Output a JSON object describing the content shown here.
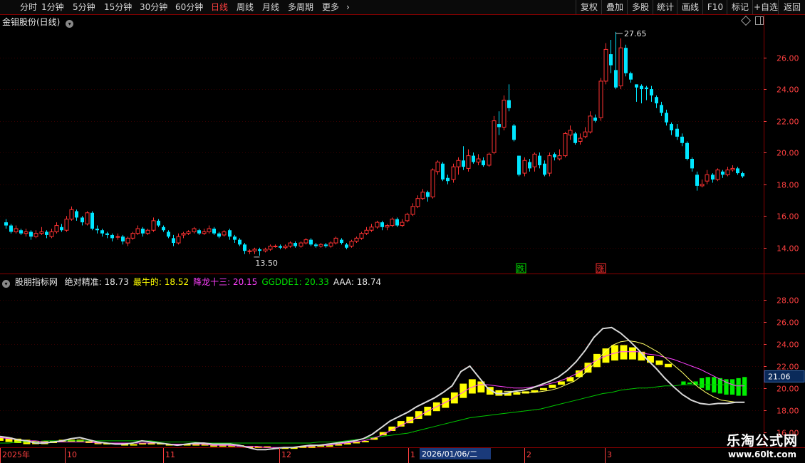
{
  "toolbar": {
    "left_items": [
      "分时",
      "1分钟",
      "5分钟",
      "15分钟",
      "30分钟",
      "60分钟",
      "日线",
      "周线",
      "月线",
      "多周期",
      "更多"
    ],
    "active": "日线",
    "more_arrow": "›",
    "right_items": [
      "复权",
      "叠加",
      "多股",
      "统计",
      "画线",
      "F10",
      "标记",
      "+自选",
      "返回"
    ]
  },
  "main_panel": {
    "title": "金钼股份(日线)",
    "title_icon": "chevron-down-icon",
    "corner_icons": [
      "diamond-icon",
      "panel-toggle-icon"
    ],
    "y_ticks": [
      "14.00",
      "16.00",
      "18.00",
      "20.00",
      "22.00",
      "24.00",
      "26.00"
    ],
    "high_label": "27.65",
    "low_label": "13.50",
    "signals": [
      {
        "text": "跌",
        "color": "#00e000"
      },
      {
        "text": "涨",
        "color": "#ff3030"
      }
    ]
  },
  "indicator_panel": {
    "name": "股朋指标网",
    "values": [
      {
        "label": "绝对精准:",
        "value": "18.73",
        "color": "#e8e8e8"
      },
      {
        "label": "最牛的:",
        "value": "18.52",
        "color": "#ffff00"
      },
      {
        "label": "降龙十三:",
        "value": "20.15",
        "color": "#ff40ff"
      },
      {
        "label": "GGDDE1:",
        "value": "20.33",
        "color": "#00e000"
      },
      {
        "label": "AAA:",
        "value": "18.74",
        "color": "#e8e8e8"
      }
    ],
    "y_ticks": [
      "16.00",
      "18.00",
      "20.00",
      "22.00",
      "24.00",
      "26.00",
      "28.00"
    ],
    "current_value": "21.06"
  },
  "date_axis": {
    "labels": [
      "2025年",
      "10",
      "11",
      "12",
      "1",
      "2",
      "3"
    ],
    "highlight": "2026/01/06/二"
  },
  "watermark": {
    "line1": "乐淘公式网",
    "line2": "www.60lt.com"
  },
  "colors": {
    "up": "#ff3232",
    "down": "#00e6ff",
    "grid": "#3a0000",
    "axis": "#8b0000",
    "tick": "#ff4040"
  },
  "chart_data": {
    "type": "candlestick",
    "y_range": [
      13,
      28
    ],
    "candles": [
      [
        15.6,
        15.4,
        15.8,
        15.2
      ],
      [
        15.4,
        15.0,
        15.5,
        14.9
      ],
      [
        15.0,
        15.2,
        15.4,
        14.9
      ],
      [
        15.1,
        14.9,
        15.2,
        14.8
      ],
      [
        14.9,
        15.0,
        15.2,
        14.7
      ],
      [
        15.0,
        14.7,
        15.1,
        14.5
      ],
      [
        14.7,
        14.9,
        15.1,
        14.6
      ],
      [
        14.9,
        15.0,
        15.3,
        14.8
      ],
      [
        15.0,
        14.8,
        15.1,
        14.6
      ],
      [
        14.7,
        15.0,
        15.2,
        14.6
      ],
      [
        15.0,
        15.4,
        15.6,
        14.9
      ],
      [
        15.3,
        15.1,
        15.5,
        15.0
      ],
      [
        15.1,
        15.8,
        16.0,
        15.0
      ],
      [
        15.8,
        16.4,
        16.6,
        15.7
      ],
      [
        16.3,
        15.9,
        16.4,
        15.7
      ],
      [
        15.9,
        15.6,
        16.0,
        15.4
      ],
      [
        15.5,
        16.2,
        16.3,
        15.4
      ],
      [
        16.2,
        15.2,
        16.3,
        15.1
      ],
      [
        15.2,
        15.1,
        15.4,
        14.9
      ],
      [
        15.1,
        14.9,
        15.2,
        14.7
      ],
      [
        14.9,
        14.8,
        15.0,
        14.6
      ],
      [
        14.8,
        14.6,
        14.9,
        14.4
      ],
      [
        14.7,
        14.7,
        14.9,
        14.5
      ],
      [
        14.7,
        14.4,
        14.8,
        14.2
      ],
      [
        14.3,
        14.6,
        14.7,
        14.1
      ],
      [
        14.6,
        14.9,
        15.0,
        14.5
      ],
      [
        14.9,
        15.2,
        15.4,
        14.8
      ],
      [
        15.2,
        14.9,
        15.3,
        14.7
      ],
      [
        14.9,
        15.1,
        15.2,
        14.8
      ],
      [
        15.1,
        15.7,
        15.9,
        15.0
      ],
      [
        15.7,
        15.4,
        15.8,
        15.3
      ],
      [
        15.3,
        15.1,
        15.4,
        15.0
      ],
      [
        15.0,
        14.7,
        15.1,
        14.6
      ],
      [
        14.6,
        14.3,
        14.8,
        14.1
      ],
      [
        14.3,
        14.7,
        14.9,
        14.2
      ],
      [
        14.8,
        14.9,
        15.0,
        14.6
      ],
      [
        14.9,
        15.0,
        15.1,
        14.8
      ],
      [
        15.0,
        15.2,
        15.3,
        14.9
      ],
      [
        15.1,
        14.9,
        15.2,
        14.8
      ],
      [
        14.9,
        15.0,
        15.2,
        14.8
      ],
      [
        15.0,
        15.2,
        15.4,
        14.9
      ],
      [
        15.2,
        14.9,
        15.3,
        14.8
      ],
      [
        14.9,
        14.7,
        15.0,
        14.6
      ],
      [
        14.8,
        15.0,
        15.1,
        14.7
      ],
      [
        15.1,
        14.7,
        15.2,
        14.5
      ],
      [
        14.7,
        14.5,
        14.8,
        14.3
      ],
      [
        14.5,
        14.2,
        14.6,
        14.1
      ],
      [
        14.2,
        13.8,
        14.3,
        13.6
      ],
      [
        13.8,
        13.8,
        13.9,
        13.6
      ],
      [
        13.8,
        13.9,
        14.0,
        13.6
      ],
      [
        13.9,
        13.8,
        14.0,
        13.5
      ],
      [
        13.8,
        13.9,
        14.0,
        13.7
      ],
      [
        13.9,
        14.1,
        14.2,
        13.8
      ],
      [
        14.1,
        14.1,
        14.2,
        14.0
      ],
      [
        14.1,
        14.0,
        14.2,
        13.9
      ],
      [
        14.0,
        14.1,
        14.2,
        13.9
      ],
      [
        14.1,
        14.3,
        14.4,
        14.0
      ],
      [
        14.3,
        14.1,
        14.4,
        14.0
      ],
      [
        14.1,
        14.3,
        14.4,
        14.0
      ],
      [
        14.3,
        14.5,
        14.6,
        14.2
      ],
      [
        14.5,
        14.2,
        14.6,
        14.1
      ],
      [
        14.2,
        14.1,
        14.3,
        14.0
      ],
      [
        14.1,
        14.2,
        14.3,
        14.0
      ],
      [
        14.2,
        14.1,
        14.3,
        14.0
      ],
      [
        14.1,
        14.3,
        14.4,
        14.0
      ],
      [
        14.3,
        14.6,
        14.7,
        14.2
      ],
      [
        14.5,
        14.3,
        14.6,
        14.2
      ],
      [
        14.2,
        14.0,
        14.3,
        13.9
      ],
      [
        14.1,
        14.4,
        14.5,
        14.0
      ],
      [
        14.4,
        14.6,
        14.7,
        14.3
      ],
      [
        14.6,
        14.9,
        15.0,
        14.5
      ],
      [
        14.9,
        15.1,
        15.3,
        14.8
      ],
      [
        15.1,
        15.3,
        15.5,
        15.0
      ],
      [
        15.3,
        15.6,
        15.7,
        15.2
      ],
      [
        15.6,
        15.3,
        15.7,
        15.1
      ],
      [
        15.3,
        15.4,
        15.5,
        15.1
      ],
      [
        15.4,
        15.8,
        15.9,
        15.3
      ],
      [
        15.8,
        15.4,
        15.9,
        15.3
      ],
      [
        15.4,
        15.6,
        15.8,
        15.3
      ],
      [
        15.7,
        16.1,
        16.2,
        15.6
      ],
      [
        16.1,
        16.6,
        16.8,
        16.0
      ],
      [
        16.6,
        17.1,
        17.3,
        16.5
      ],
      [
        17.1,
        17.5,
        17.7,
        17.0
      ],
      [
        17.5,
        17.2,
        17.6,
        16.9
      ],
      [
        17.2,
        18.9,
        19.0,
        17.1
      ],
      [
        18.8,
        19.4,
        19.5,
        18.6
      ],
      [
        19.3,
        18.3,
        19.4,
        18.2
      ],
      [
        18.4,
        18.2,
        18.6,
        18.0
      ],
      [
        18.3,
        19.1,
        19.3,
        18.1
      ],
      [
        19.1,
        19.5,
        19.7,
        18.6
      ],
      [
        19.5,
        19.1,
        20.4,
        18.9
      ],
      [
        19.0,
        19.8,
        20.2,
        18.8
      ],
      [
        19.8,
        19.4,
        20.0,
        19.3
      ],
      [
        19.4,
        19.6,
        19.9,
        19.2
      ],
      [
        19.5,
        19.2,
        19.7,
        19.1
      ],
      [
        19.2,
        19.9,
        20.0,
        19.1
      ],
      [
        20.0,
        22.0,
        22.3,
        19.9
      ],
      [
        21.8,
        21.6,
        22.6,
        21.1
      ],
      [
        21.6,
        23.3,
        23.6,
        21.4
      ],
      [
        23.3,
        22.8,
        24.3,
        22.6
      ],
      [
        21.7,
        20.8,
        21.8,
        20.7
      ],
      [
        19.8,
        18.6,
        19.8,
        18.5
      ],
      [
        18.7,
        19.5,
        19.7,
        18.5
      ],
      [
        19.4,
        19.0,
        19.6,
        18.8
      ],
      [
        19.1,
        19.9,
        20.0,
        18.8
      ],
      [
        19.8,
        19.2,
        20.0,
        19.0
      ],
      [
        19.3,
        18.6,
        19.5,
        18.5
      ],
      [
        18.7,
        19.8,
        20.0,
        18.5
      ],
      [
        19.9,
        19.7,
        20.0,
        19.5
      ],
      [
        19.6,
        19.8,
        20.2,
        19.5
      ],
      [
        19.8,
        21.2,
        21.3,
        19.7
      ],
      [
        21.1,
        21.4,
        21.7,
        20.8
      ],
      [
        21.2,
        20.6,
        21.3,
        20.5
      ],
      [
        20.7,
        20.9,
        21.2,
        20.5
      ],
      [
        21.0,
        21.3,
        21.6,
        20.9
      ],
      [
        21.3,
        22.3,
        22.6,
        21.2
      ],
      [
        22.2,
        22.0,
        22.4,
        21.9
      ],
      [
        22.2,
        24.5,
        24.7,
        22.0
      ],
      [
        24.5,
        26.5,
        26.9,
        24.3
      ],
      [
        26.2,
        25.5,
        27.1,
        25.0
      ],
      [
        25.2,
        24.1,
        27.6,
        24.0
      ],
      [
        24.2,
        26.6,
        27.2,
        24.0
      ],
      [
        26.6,
        25.0,
        26.8,
        24.8
      ],
      [
        25.0,
        24.6,
        25.1,
        24.4
      ],
      [
        24.3,
        24.1,
        24.3,
        23.2
      ],
      [
        24.2,
        24.0,
        24.3,
        23.1
      ],
      [
        24.1,
        24.0,
        24.2,
        23.3
      ],
      [
        24.0,
        23.6,
        24.2,
        23.2
      ],
      [
        23.5,
        23.1,
        23.6,
        22.8
      ],
      [
        23.0,
        22.5,
        23.2,
        22.3
      ],
      [
        22.5,
        21.9,
        22.7,
        21.7
      ],
      [
        21.8,
        21.4,
        21.9,
        21.1
      ],
      [
        21.5,
        21.0,
        21.8,
        20.8
      ],
      [
        21.0,
        20.6,
        21.2,
        20.4
      ],
      [
        20.6,
        19.6,
        20.7,
        19.5
      ],
      [
        19.6,
        19.0,
        19.7,
        18.8
      ],
      [
        18.6,
        17.9,
        18.8,
        17.6
      ],
      [
        17.9,
        18.0,
        18.3,
        17.8
      ],
      [
        18.2,
        18.6,
        18.9,
        18.0
      ],
      [
        18.6,
        18.3,
        18.7,
        18.1
      ],
      [
        18.3,
        18.9,
        19.0,
        18.2
      ],
      [
        18.8,
        18.6,
        18.9,
        18.4
      ],
      [
        18.6,
        18.9,
        19.1,
        18.5
      ],
      [
        18.9,
        19.0,
        19.2,
        18.8
      ],
      [
        19.0,
        18.7,
        19.1,
        18.6
      ],
      [
        18.7,
        18.5,
        18.8,
        18.4
      ]
    ],
    "indicator": {
      "y_range": [
        15,
        29.5
      ],
      "white_line": [
        15.6,
        15.5,
        15.3,
        15.2,
        15.0,
        15.0,
        15.1,
        15.2,
        15.4,
        15.5,
        15.3,
        15.1,
        15.0,
        14.9,
        14.9,
        15.0,
        15.2,
        15.1,
        15.0,
        14.9,
        14.8,
        14.9,
        15.0,
        15.0,
        14.9,
        14.9,
        14.9,
        14.8,
        14.6,
        14.4,
        14.4,
        14.5,
        14.6,
        14.6,
        14.7,
        14.8,
        14.8,
        14.9,
        15.0,
        15.1,
        15.2,
        15.4,
        15.8,
        16.4,
        17.0,
        17.4,
        17.8,
        18.3,
        18.7,
        19.1,
        19.6,
        20.2,
        21.5,
        22.0,
        21.0,
        20.0,
        19.5,
        19.5,
        19.7,
        19.8,
        20.0,
        20.3,
        20.6,
        21.0,
        21.6,
        22.4,
        23.4,
        24.6,
        25.4,
        25.5,
        25.0,
        24.3,
        23.5,
        22.6,
        21.8,
        20.9,
        20.1,
        19.4,
        18.9,
        18.6,
        18.5,
        18.6,
        18.6,
        18.7,
        18.7
      ],
      "white_start": 0,
      "yellow_bar_top": [
        15.2,
        15.1,
        15.0,
        14.9,
        14.9,
        14.9,
        15.0,
        15.1,
        15.1,
        15.1,
        15.0,
        14.9,
        14.9,
        14.9,
        14.9,
        14.9,
        15.0,
        15.0,
        15.0,
        14.9,
        14.9,
        14.9,
        14.9,
        14.9,
        14.8,
        14.8,
        14.8,
        14.7,
        14.6,
        14.6,
        14.6,
        14.6,
        14.6,
        14.6,
        14.7,
        14.7,
        14.8,
        14.8,
        14.9,
        15.0,
        15.1,
        15.2,
        15.5,
        16.0,
        16.5,
        17.0,
        17.4,
        17.9,
        18.3,
        18.7,
        19.1,
        19.6,
        20.4,
        20.8,
        20.6,
        20.1,
        19.8,
        19.6,
        19.6,
        19.7,
        19.8,
        20.0,
        20.3,
        20.6,
        21.0,
        21.6,
        22.3,
        23.1,
        23.6,
        23.9,
        23.9,
        23.7,
        23.3,
        22.9,
        22.5,
        22.2
      ],
      "yellow_bar_bottom": [
        15.6,
        15.5,
        15.4,
        15.3,
        15.2,
        15.2,
        15.2,
        15.3,
        15.3,
        15.3,
        15.2,
        15.1,
        15.0,
        15.0,
        14.9,
        14.9,
        15.0,
        15.0,
        14.9,
        14.9,
        14.8,
        14.8,
        14.8,
        14.8,
        14.8,
        14.8,
        14.8,
        14.8,
        14.7,
        14.7,
        14.7,
        14.6,
        14.6,
        14.6,
        14.6,
        14.7,
        14.7,
        14.8,
        14.8,
        14.9,
        15.0,
        15.1,
        15.3,
        15.7,
        16.1,
        16.5,
        16.8,
        17.2,
        17.5,
        17.9,
        18.2,
        18.6,
        19.1,
        19.5,
        19.6,
        19.4,
        19.3,
        19.3,
        19.4,
        19.5,
        19.6,
        19.8,
        20.0,
        20.3,
        20.6,
        21.0,
        21.4,
        21.9,
        22.3,
        22.5,
        22.6,
        22.6,
        22.5,
        22.3,
        22.1,
        21.9
      ],
      "green_bar_top": [
        20.3,
        20.4,
        20.6,
        20.9,
        21.0,
        21.0,
        20.9,
        20.8,
        20.8,
        20.9,
        21.0
      ],
      "green_bar_bottom": [
        20.6,
        20.5,
        20.3,
        20.0,
        19.8,
        19.6,
        19.5,
        19.4,
        19.4,
        19.3,
        19.3
      ],
      "magenta_line": [
        15.5,
        15.4,
        15.3,
        15.2,
        15.2,
        15.1,
        15.1,
        15.1,
        15.1,
        15.1,
        15.1,
        15.0,
        15.0,
        15.0,
        15.0,
        15.0,
        15.0,
        15.0,
        15.0,
        14.9,
        14.9,
        14.9,
        14.9,
        14.9,
        14.8,
        14.8,
        14.8,
        14.7,
        14.7,
        14.7,
        14.6,
        14.6,
        14.6,
        14.6,
        14.7,
        14.7,
        14.8,
        14.8,
        14.9,
        15.0,
        15.1,
        15.2,
        15.4,
        15.7,
        16.1,
        16.5,
        16.9,
        17.3,
        17.8,
        18.2,
        18.6,
        19.0,
        19.5,
        20.0,
        20.3,
        20.3,
        20.2,
        20.1,
        20.0,
        20.0,
        20.1,
        20.2,
        20.4,
        20.6,
        20.9,
        21.3,
        21.8,
        22.4,
        22.8,
        23.1,
        23.3,
        23.3,
        23.3,
        23.1,
        23.0,
        22.8,
        22.6,
        22.3,
        22.0,
        21.7,
        21.3,
        20.9,
        20.5,
        20.2,
        20.2
      ],
      "green_line": [
        15.0,
        15.0,
        15.1,
        15.1,
        15.1,
        15.2,
        15.2,
        15.2,
        15.2,
        15.2,
        15.2,
        15.2,
        15.2,
        15.2,
        15.2,
        15.2,
        15.2,
        15.2,
        15.1,
        15.1,
        15.1,
        15.1,
        15.1,
        15.0,
        15.0,
        15.0,
        15.0,
        15.0,
        15.0,
        15.0,
        15.0,
        15.0,
        15.0,
        15.0,
        15.0,
        15.0,
        15.1,
        15.1,
        15.1,
        15.2,
        15.3,
        15.4,
        15.5,
        15.6,
        15.7,
        15.8,
        15.9,
        16.1,
        16.3,
        16.5,
        16.7,
        16.9,
        17.1,
        17.3,
        17.4,
        17.5,
        17.6,
        17.7,
        17.8,
        17.9,
        18.0,
        18.1,
        18.3,
        18.5,
        18.7,
        18.9,
        19.1,
        19.3,
        19.5,
        19.6,
        19.8,
        19.9,
        20.0,
        20.0,
        20.1,
        20.2,
        20.2,
        20.3,
        20.3,
        20.3,
        20.3,
        20.3,
        20.3,
        20.3,
        20.3
      ],
      "thin_yellow_line": [
        19.7,
        19.7,
        19.6,
        19.6,
        19.6,
        19.7,
        19.8,
        20.0,
        20.3,
        20.6,
        21.1,
        21.7,
        22.5,
        23.3,
        23.9,
        24.2,
        24.3,
        24.2,
        24.0,
        23.6,
        23.2,
        22.6,
        22.0,
        21.4,
        20.7,
        20.1,
        19.6,
        19.2,
        18.9,
        18.8,
        18.7,
        18.7
      ]
    }
  }
}
